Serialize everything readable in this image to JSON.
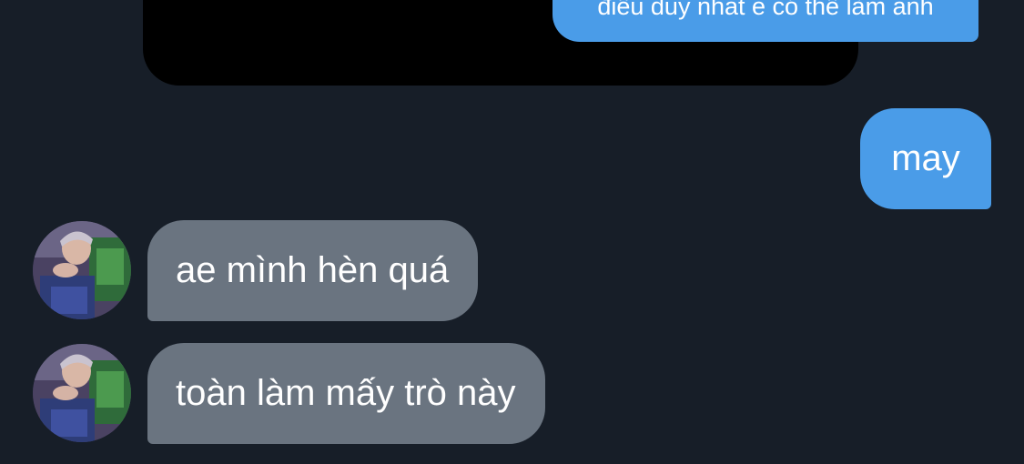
{
  "conversation": {
    "quoted_message": {
      "text": "điều duy nhất e có thể làm anh"
    },
    "messages": [
      {
        "direction": "outgoing",
        "text": "may"
      },
      {
        "direction": "incoming",
        "text": "ae mình hèn quá",
        "avatar": "user-avatar-photo"
      },
      {
        "direction": "incoming",
        "text": "toàn làm mấy trò này",
        "avatar": "user-avatar-photo"
      }
    ]
  },
  "colors": {
    "background": "#171e28",
    "outgoing_bubble": "#4a9ce8",
    "incoming_bubble": "#6a7480",
    "quote_container": "#000000"
  }
}
